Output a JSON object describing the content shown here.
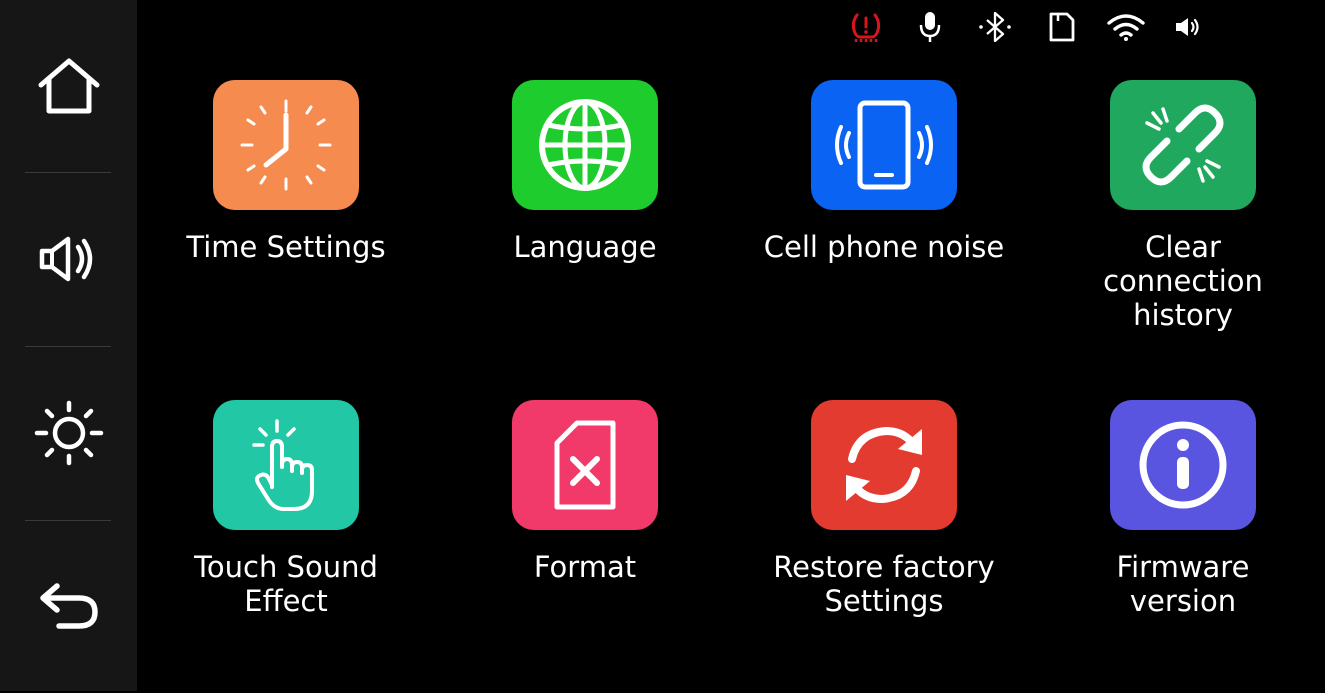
{
  "sidebar": {
    "items": [
      {
        "name": "home",
        "icon": "home-icon"
      },
      {
        "name": "volume",
        "icon": "volume-icon"
      },
      {
        "name": "brightness",
        "icon": "brightness-icon"
      },
      {
        "name": "back",
        "icon": "back-arrow-icon"
      }
    ]
  },
  "status_bar": {
    "icons": [
      "tire-pressure-warning-icon",
      "microphone-icon",
      "bluetooth-icon",
      "sd-card-icon",
      "wifi-icon",
      "speaker-icon"
    ],
    "warning_color": "#d8151c"
  },
  "tiles": [
    {
      "label": "Time Settings",
      "icon": "clock-icon",
      "color": "#f68b4f"
    },
    {
      "label": "Language",
      "icon": "globe-icon",
      "color": "#1fcc2d"
    },
    {
      "label": "Cell phone noise",
      "icon": "phone-vibrate-icon",
      "color": "#0a63f2"
    },
    {
      "label": "Clear\nconnection\nhistory",
      "icon": "broken-link-icon",
      "color": "#20a85e"
    },
    {
      "label": "Touch Sound\nEffect",
      "icon": "touch-hand-icon",
      "color": "#22c8a6"
    },
    {
      "label": "Format",
      "icon": "sd-card-format-icon",
      "color": "#f23a6a"
    },
    {
      "label": "Restore factory\nSettings",
      "icon": "restore-icon",
      "color": "#e43b30"
    },
    {
      "label": "Firmware\nversion",
      "icon": "info-icon",
      "color": "#5a55e0"
    }
  ]
}
